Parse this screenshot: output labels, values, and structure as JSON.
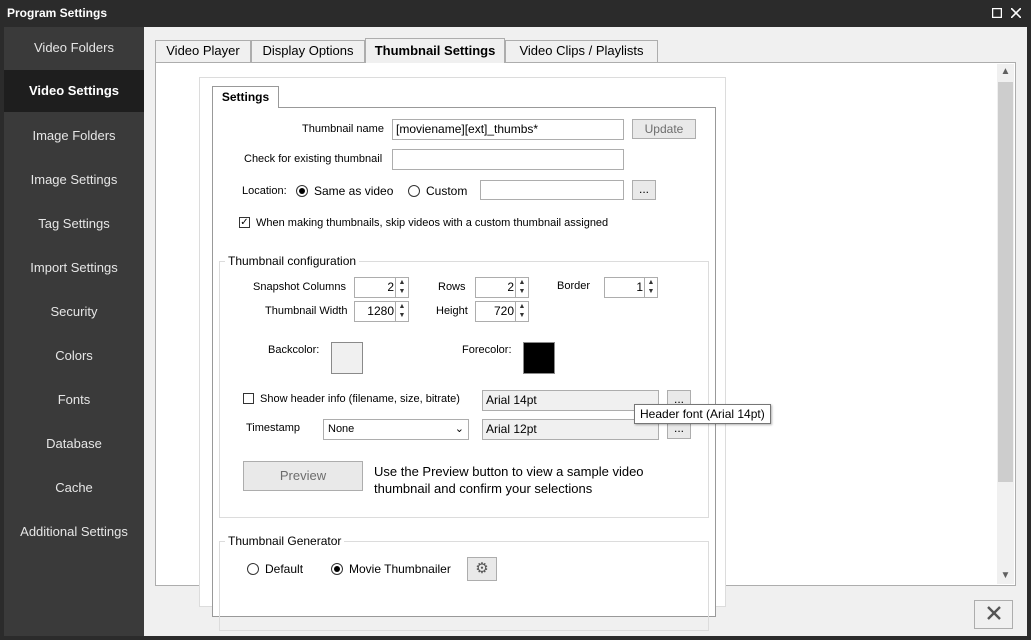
{
  "window": {
    "title": "Program Settings",
    "maximize_icon": "maximize-icon",
    "close_icon": "close-icon"
  },
  "sidebar": {
    "items": [
      {
        "label": "Video Folders"
      },
      {
        "label": "Video Settings",
        "active": true
      },
      {
        "label": "Image Folders"
      },
      {
        "label": "Image Settings"
      },
      {
        "label": "Tag Settings"
      },
      {
        "label": "Import Settings"
      },
      {
        "label": "Security"
      },
      {
        "label": "Colors"
      },
      {
        "label": "Fonts"
      },
      {
        "label": "Database"
      },
      {
        "label": "Cache"
      },
      {
        "label": "Additional Settings"
      }
    ]
  },
  "tabs": [
    {
      "label": "Video Player"
    },
    {
      "label": "Display Options"
    },
    {
      "label": "Thumbnail Settings",
      "active": true
    },
    {
      "label": "Video Clips / Playlists"
    }
  ],
  "settings": {
    "tab_label": "Settings",
    "thumbnail_name": {
      "label": "Thumbnail name",
      "value": "[moviename][ext]_thumbs*",
      "button": "Update"
    },
    "existing": {
      "label": "Check for existing thumbnail",
      "value": ""
    },
    "location": {
      "label": "Location:",
      "option_same": "Same as video",
      "option_custom": "Custom",
      "selected": "Same as video",
      "custom_value": "",
      "browse": "..."
    },
    "skip_custom": {
      "label": "When making thumbnails, skip videos with a custom thumbnail assigned",
      "checked": true
    }
  },
  "config": {
    "title": "Thumbnail configuration",
    "snapshot_columns": {
      "label": "Snapshot Columns",
      "value": "2"
    },
    "rows": {
      "label": "Rows",
      "value": "2"
    },
    "border": {
      "label": "Border",
      "value": "1"
    },
    "thumb_width": {
      "label": "Thumbnail Width",
      "value": "1280"
    },
    "height": {
      "label": "Height",
      "value": "720"
    },
    "backcolor": {
      "label": "Backcolor:",
      "color": "#f0f0f0"
    },
    "forecolor": {
      "label": "Forecolor:",
      "color": "#000000"
    },
    "header_info": {
      "label": "Show header info (filename, size, bitrate)",
      "checked": false,
      "font": "Arial 14pt",
      "browse": "..."
    },
    "timestamp": {
      "label": "Timestamp",
      "selected": "None",
      "font": "Arial 12pt",
      "browse": "..."
    },
    "preview": {
      "button": "Preview",
      "help": "Use the Preview button to view a sample video thumbnail and confirm your selections"
    }
  },
  "tooltip": {
    "text": "Header font (Arial 14pt)"
  },
  "generator": {
    "title": "Thumbnail Generator",
    "option_default": "Default",
    "option_movie": "Movie Thumbnailer",
    "selected": "Movie Thumbnailer",
    "settings_icon": "gear-icon"
  },
  "footer": {
    "close_icon": "close-icon"
  }
}
